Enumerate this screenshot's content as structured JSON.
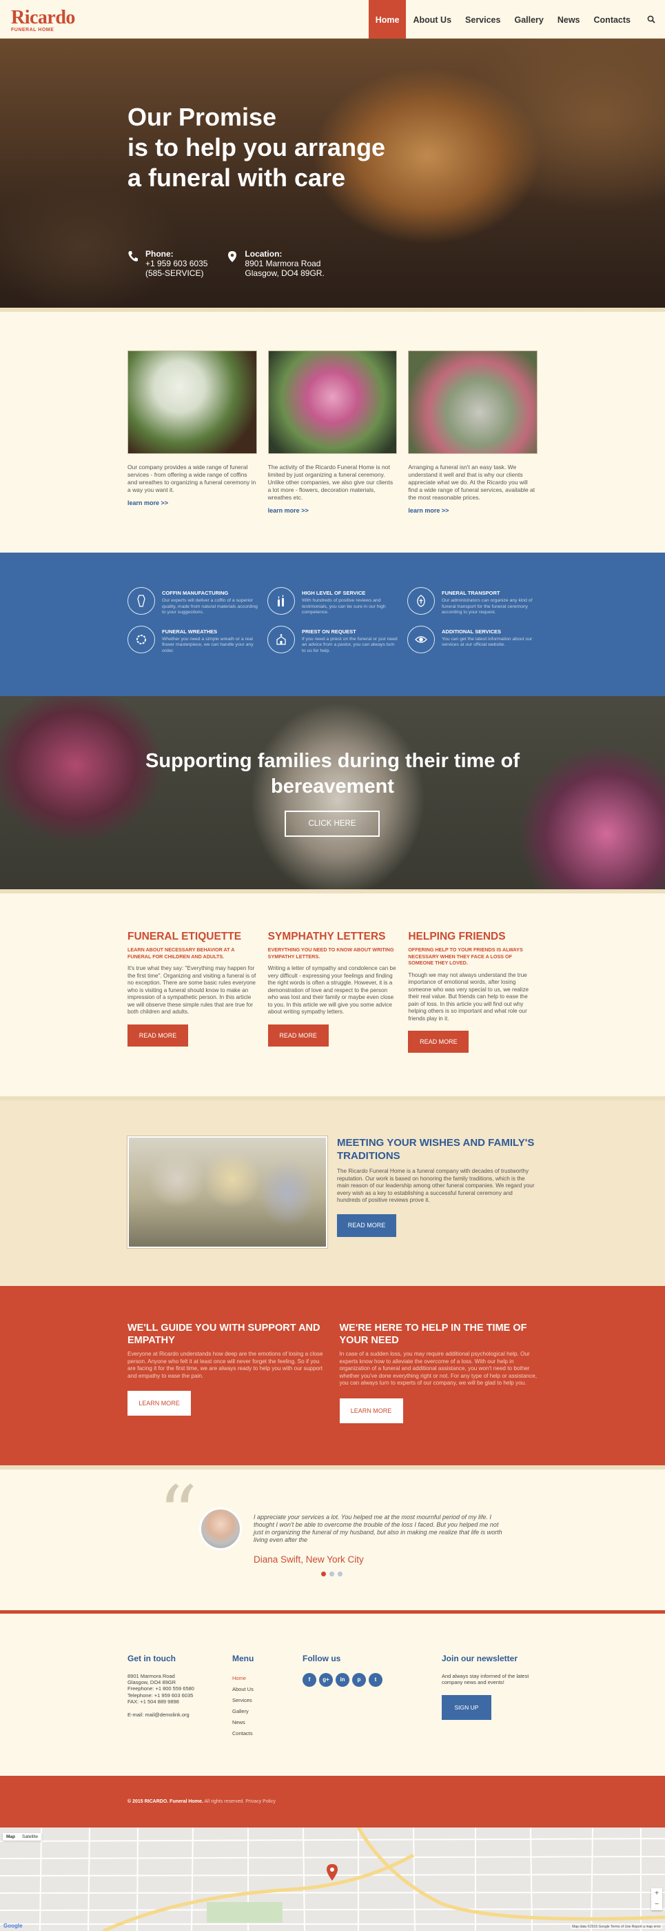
{
  "brand": {
    "name": "Ricardo",
    "tagline": "FUNERAL HOME"
  },
  "nav": {
    "items": [
      "Home",
      "About Us",
      "Services",
      "Gallery",
      "News",
      "Contacts"
    ],
    "active": "Home"
  },
  "hero": {
    "title_lines": [
      "Our Promise",
      "is to help you arrange",
      "a funeral with care"
    ],
    "phone": {
      "label": "Phone:",
      "lines": [
        "+1 959 603 6035",
        "(585-SERVICE)"
      ]
    },
    "location": {
      "label": "Location:",
      "lines": [
        "8901 Marmora Road",
        "Glasgow, DO4 89GR."
      ]
    }
  },
  "services": [
    {
      "text": "Our company provides a wide range of funeral services - from offering a wide range of coffins and wreathes to organizing a funeral ceremony in a way you want it.",
      "link": "learn more >>"
    },
    {
      "text": "The activity of the Ricardo Funeral Home is not limited by just organizing a funeral ceremony. Unlike other companies, we also give our clients a lot more - flowers, decoration materials, wreathes etc.",
      "link": "learn more >>"
    },
    {
      "text": "Arranging a funeral isn't an easy task. We understand it well and that is why our clients appreciate what we do. At the Ricardo you will find a wide range of funeral services, available at the most reasonable prices.",
      "link": "learn more >>"
    }
  ],
  "features": [
    {
      "icon": "coffin-icon",
      "title": "COFFIN MANUFACTURING",
      "text": "Our experts will deliver a coffin of a superior quality, made from natural materials according to your suggestions."
    },
    {
      "icon": "candles-icon",
      "title": "HIGH LEVEL OF SERVICE",
      "text": "With hundreds of positive reviews and testimonials, you can be sure in our high competence."
    },
    {
      "icon": "hearse-icon",
      "title": "FUNERAL TRANSPORT",
      "text": "Our administrators can organize any kind of funeral transport for the funeral ceremony according to your request."
    },
    {
      "icon": "wreath-icon",
      "title": "FUNERAL WREATHES",
      "text": "Whether you need a simple wreath or a real flower masterpiece, we can handle your any order."
    },
    {
      "icon": "church-icon",
      "title": "PRIEST ON REQUEST",
      "text": "If you need a priest on the funeral or just need an advice from a pastor, you can always turn to us for help."
    },
    {
      "icon": "eye-icon",
      "title": "ADDITIONAL SERVICES",
      "text": "You can get the latest information about our services at our official website."
    }
  ],
  "banner": {
    "title_lines": [
      "Supporting families during their time of",
      "bereavement"
    ],
    "button": "CLICK HERE"
  },
  "articles": [
    {
      "title": "FUNERAL ETIQUETTE",
      "subtitle": "LEARN ABOUT NECESSARY BEHAVIOR AT A FUNERAL FOR CHILDREN AND ADULTS.",
      "text": "It's true what they say: \"Everything may happen for the first time\". Organizing and visiting a funeral is of no exception. There are some basic rules everyone who is visiting a funeral should know to make an impression of a sympathetic person. In this article we will observe these simple rules that are true for both children and adults.",
      "button": "READ MORE"
    },
    {
      "title": "SYMPHATHY LETTERS",
      "subtitle": "EVERYTHING YOU NEED TO KNOW ABOUT WRITING SYMPATHY LETTERS.",
      "text": "Writing a letter of sympathy and condolence can be very difficult - expressing your feelings and finding the right words is often a struggle. However, it is a demonstration of love and respect to the person who was lost and their family or maybe even close to you. In this article we will give you some advice about writing sympathy letters.",
      "button": "READ MORE"
    },
    {
      "title": "HELPING FRIENDS",
      "subtitle": "OFFERING HELP TO YOUR FRIENDS IS ALWAYS NECESSARY WHEN THEY FACE A LOSS OF SOMEONE THEY LOVED.",
      "text": "Though we may not always understand the true importance of emotional words, after losing someone who was very special to us, we realize their real value. But friends can help to ease the pain of loss. In this article you will find out why helping others is so important and what role our friends play in it.",
      "button": "READ MORE"
    }
  ],
  "meeting": {
    "title_lines": [
      "MEETING YOUR WISHES AND FAMILY'S",
      "TRADITIONS"
    ],
    "text": "The Ricardo Funeral Home is a funeral company with decades of trustworthy reputation. Our work is based on honoring the family traditions, which is the main reason of our leadership among other funeral companies. We regard your every wish as a key to establishing a successful funeral ceremony and hundreds of positive reviews prove it.",
    "button": "READ MORE"
  },
  "red_cta": [
    {
      "title_lines": [
        "WE'LL GUIDE YOU WITH SUPPORT AND",
        "EMPATHY"
      ],
      "text": "Everyone at Ricardo understands how deep are the emotions of losing a close person. Anyone who felt it at least once will never forget the feeling. So if you are facing it for the first time, we are always ready to help you with our support and empathy to ease the pain.",
      "button": "LEARN MORE"
    },
    {
      "title_lines": [
        "WE'RE HERE TO HELP IN THE TIME OF",
        "YOUR NEED"
      ],
      "text": "In case of a sudden loss, you may require additional psychological help. Our experts know how to alleviate the overcome of a loss. With our help in organization of a funeral and additional assistance, you won't need to bother whether you've done everything right or not. For any type of help or assistance, you can always turn to experts of our company, we will be glad to help you.",
      "button": "LEARN MORE"
    }
  ],
  "testimonial": {
    "quote": "I appreciate your services a lot. You helped me at the most mournful period of my life. I thought I won't be able to overcome the trouble of the loss I faced. But you helped me not just in organizing the funeral of my husband, but also in making me realize that life is worth living even after the",
    "author": "Diana Swift, New York City",
    "active_slide": 1,
    "slides": 3
  },
  "footer": {
    "contact": {
      "title": "Get in touch",
      "address_lines": [
        "8901 Marmora Road",
        "Glasgow, DO4 89GR",
        "Freephone: +1 800 559 6580",
        "Telephone: +1 959 603 6035",
        "FAX: +1 504 889 9898"
      ],
      "email": "E-mail: mail@demolink.org"
    },
    "menu": {
      "title": "Menu",
      "items": [
        "Home",
        "About Us",
        "Services",
        "Gallery",
        "News",
        "Contacts"
      ]
    },
    "follow": {
      "title": "Follow us",
      "icons": [
        "facebook-icon",
        "google-plus-icon",
        "linkedin-icon",
        "pinterest-icon",
        "twitter-icon"
      ],
      "glyphs": [
        "f",
        "g+",
        "in",
        "p",
        "t"
      ]
    },
    "newsletter": {
      "title": "Join our newsletter",
      "text": "And always stay informed of the latest company news and events!",
      "button": "SIGN UP"
    }
  },
  "copyright": {
    "brand": "© 2015 RICARDO. Funeral Home.",
    "rest": " All rights reserved. Privacy Policy"
  },
  "map": {
    "controls": [
      "Map",
      "Satellite"
    ],
    "google": "Google",
    "terms": "Map data ©2015 Google   Terms of Use   Report a map error"
  },
  "colors": {
    "accent_red": "#cc4b32",
    "brand_blue": "#3d6aa4",
    "cream": "#fdf8e8"
  }
}
